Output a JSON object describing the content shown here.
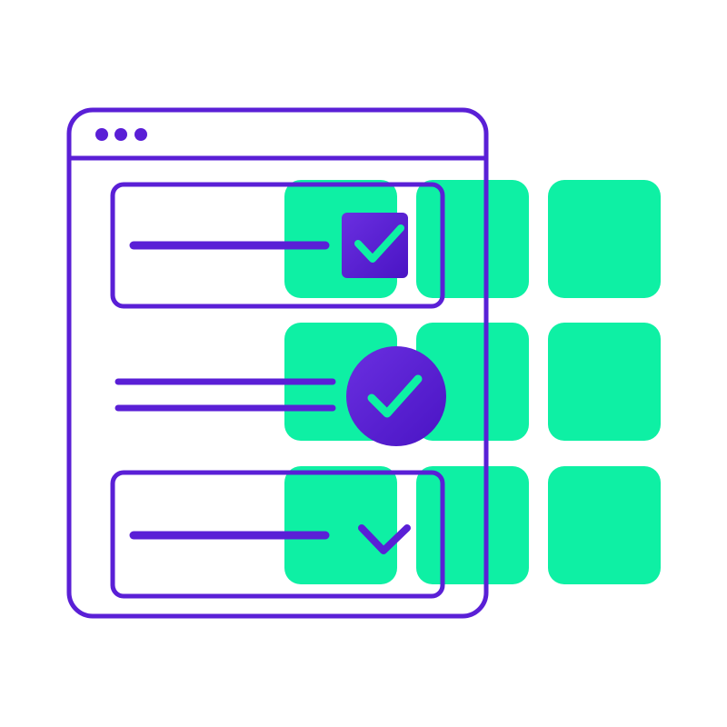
{
  "colors": {
    "background": "#ffffff",
    "accent_green": "#0ef0a4",
    "purple_stroke": "#5a1fd6",
    "purple_gradient_start": "#6a2fe0",
    "purple_gradient_end": "#4a14c4"
  },
  "icons": {
    "window": "browser-window-icon",
    "window_dots": "window-controls-icon",
    "checkbox": "checked-checkbox-icon",
    "check_circle": "check-circle-icon",
    "dropdown": "chevron-down-icon"
  },
  "rows": [
    {
      "type": "checkbox",
      "state": "checked"
    },
    {
      "type": "radio",
      "state": "checked"
    },
    {
      "type": "select",
      "state": "collapsed"
    }
  ]
}
